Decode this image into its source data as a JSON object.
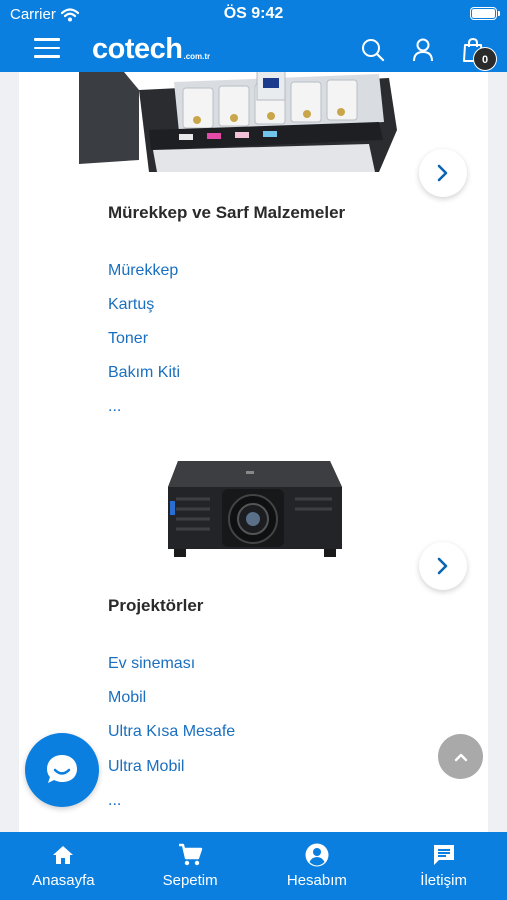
{
  "status_bar": {
    "carrier": "Carrier",
    "time": "ÖS 9:42"
  },
  "header": {
    "logo_main": "cotech",
    "logo_tld": ".com.tr",
    "cart_count": "0"
  },
  "categories": [
    {
      "title": "Mürekkep ve Sarf Malzemeler",
      "image_icon": "printer-ink-tank-image",
      "links": [
        "Mürekkep",
        "Kartuş",
        "Toner",
        "Bakım Kiti",
        "..."
      ]
    },
    {
      "title": "Projektörler",
      "image_icon": "projector-image",
      "links": [
        "Ev sineması",
        "Mobil",
        "Ultra Kısa Mesafe",
        "Ultra Mobil",
        "..."
      ]
    }
  ],
  "tabbar": {
    "items": [
      {
        "label": "Anasayfa",
        "icon": "home-icon"
      },
      {
        "label": "Sepetim",
        "icon": "cart-icon"
      },
      {
        "label": "Hesabım",
        "icon": "account-icon"
      },
      {
        "label": "İletişim",
        "icon": "message-icon"
      }
    ]
  },
  "colors": {
    "brand_blue": "#0a7fe0",
    "link_blue": "#1a6fbf",
    "title_dark": "#2a2a2a"
  }
}
